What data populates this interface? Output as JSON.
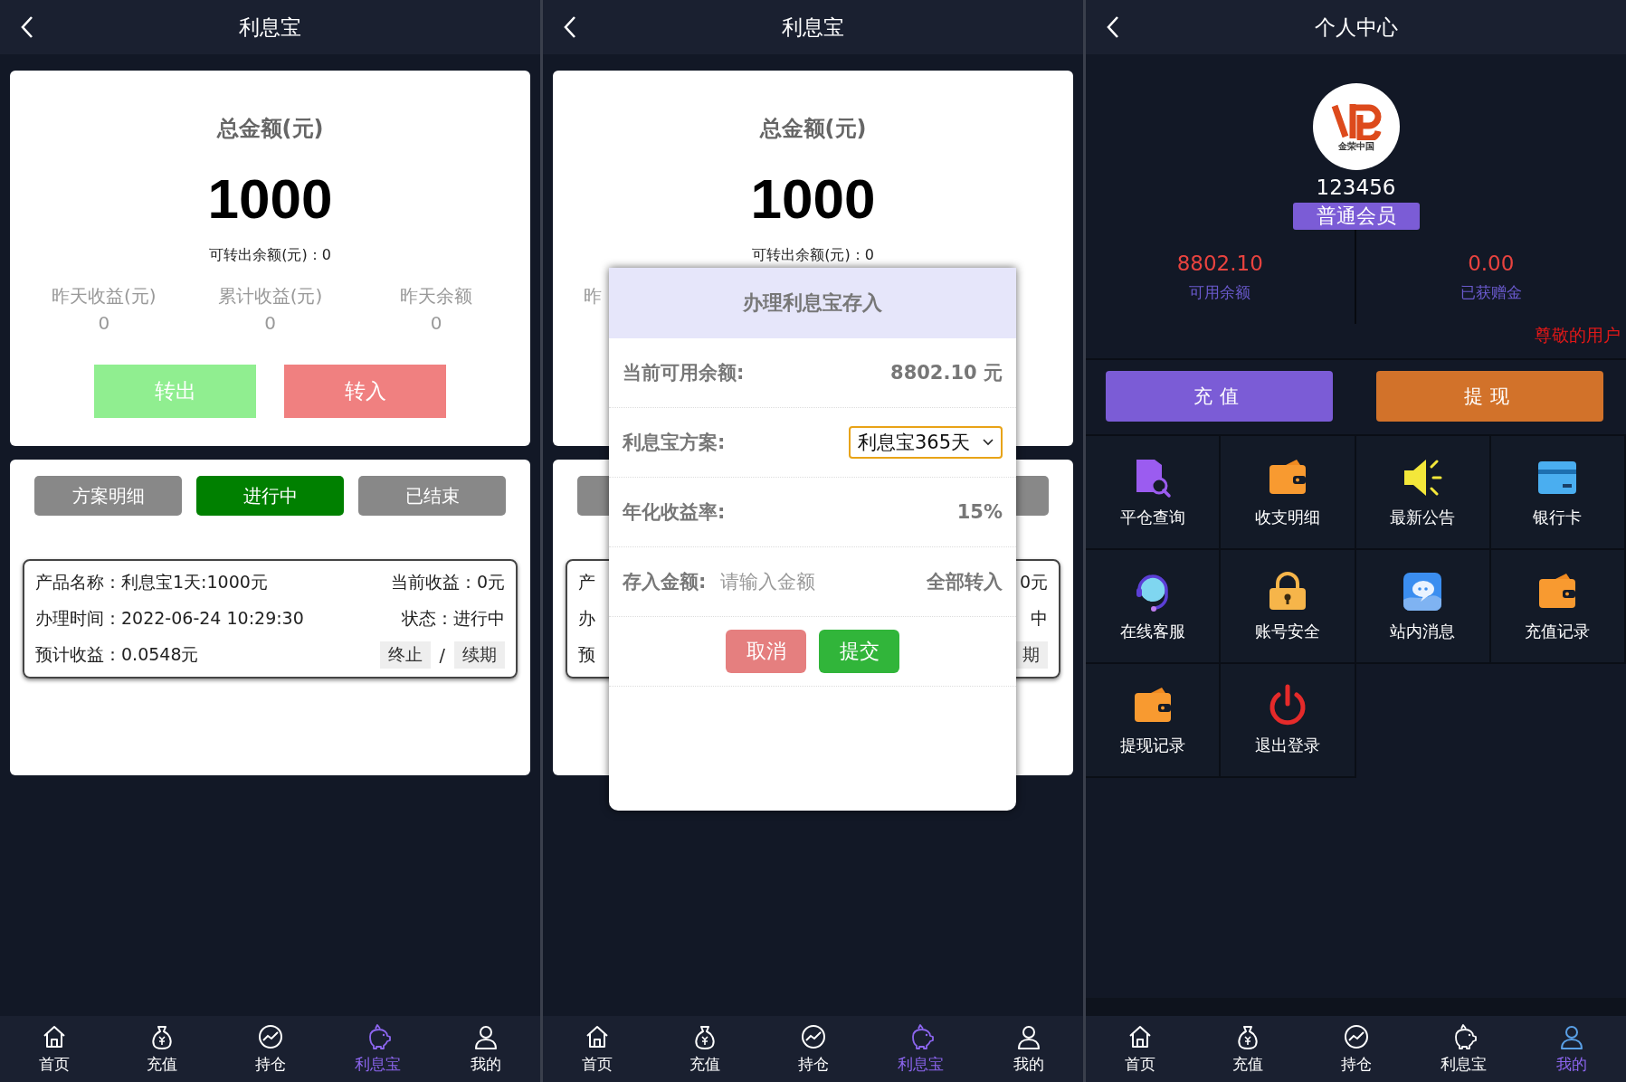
{
  "panels": [
    {
      "kind": "wealth",
      "title": "利息宝",
      "summary": {
        "title": "总金额(元)",
        "amount": "1000",
        "available": "可转出余额(元)：0",
        "stats": [
          {
            "label": "昨天收益(元)",
            "value": "0"
          },
          {
            "label": "累计收益(元)",
            "value": "0"
          },
          {
            "label": "昨天余额",
            "value": "0"
          }
        ],
        "actions": [
          {
            "kind": "out",
            "label": "转出"
          },
          {
            "kind": "in",
            "label": "转入"
          }
        ]
      },
      "tabs": [
        {
          "label": "方案明细",
          "selected": false
        },
        {
          "label": "进行中",
          "selected": true
        },
        {
          "label": "已结束",
          "selected": false
        }
      ],
      "record": [
        {
          "left": "产品名称：利息宝1天:1000元",
          "right": "当前收益：0元"
        },
        {
          "left": "办理时间：2022-06-24 10:29:30",
          "right": "状态：进行中"
        },
        {
          "left": "预计收益：0.0548元",
          "actions": [
            {
              "kind": "button",
              "label": "终止"
            },
            {
              "kind": "separator",
              "label": "/"
            },
            {
              "kind": "button",
              "label": "续期"
            }
          ]
        }
      ],
      "nav": [
        {
          "label": "首页",
          "selected": false
        },
        {
          "label": "充值",
          "selected": false
        },
        {
          "label": "持仓",
          "selected": false
        },
        {
          "label": "利息宝",
          "selected": true
        },
        {
          "label": "我的",
          "selected": false
        }
      ]
    },
    {
      "kind": "wealth_dialog",
      "title": "利息宝",
      "summary": {
        "title": "总金额(元)",
        "amount": "1000",
        "available": "可转出余额(元)：0",
        "stat_fragment": "昨"
      },
      "record_fragments": [
        {
          "left": "产",
          "right": "0元"
        },
        {
          "left": "办",
          "right": "中"
        },
        {
          "left": "预",
          "right": "期"
        }
      ],
      "dialog": {
        "title": "办理利息宝存入",
        "balance": {
          "label": "当前可用余额:",
          "value": "8802.10 元"
        },
        "plan": {
          "label": "利息宝方案:",
          "value": "利息宝365天"
        },
        "rate": {
          "label": "年化收益率:",
          "value": "15%"
        },
        "amount": {
          "label": "存入金额:",
          "placeholder": "请输入金额",
          "link": "全部转入"
        },
        "buttons": [
          {
            "kind": "cancel",
            "label": "取消"
          },
          {
            "kind": "submit",
            "label": "提交"
          }
        ]
      },
      "nav": [
        {
          "label": "首页",
          "selected": false
        },
        {
          "label": "充值",
          "selected": false
        },
        {
          "label": "持仓",
          "selected": false
        },
        {
          "label": "利息宝",
          "selected": true
        },
        {
          "label": "我的",
          "selected": false
        }
      ]
    },
    {
      "kind": "profile",
      "title": "个人中心",
      "avatar": {
        "logo_text": "金荣中国"
      },
      "username": "123456",
      "level": "普通会员",
      "stats": [
        {
          "value": "8802.10",
          "label": "可用余额"
        },
        {
          "value": "0.00",
          "label": "已获赠金"
        }
      ],
      "note": "尊敬的用户",
      "actions": [
        {
          "kind": "recharge",
          "label": "充值"
        },
        {
          "kind": "withdraw",
          "label": "提现"
        }
      ],
      "menu": [
        {
          "label": "平仓查询"
        },
        {
          "label": "收支明细"
        },
        {
          "label": "最新公告"
        },
        {
          "label": "银行卡"
        },
        {
          "label": "在线客服"
        },
        {
          "label": "账号安全"
        },
        {
          "label": "站内消息"
        },
        {
          "label": "充值记录"
        },
        {
          "label": "提现记录"
        },
        {
          "label": "退出登录"
        }
      ],
      "nav": [
        {
          "label": "首页",
          "selected": false
        },
        {
          "label": "充值",
          "selected": false
        },
        {
          "label": "持仓",
          "selected": false
        },
        {
          "label": "利息宝",
          "selected": false
        },
        {
          "label": "我的",
          "selected": true
        }
      ]
    }
  ]
}
